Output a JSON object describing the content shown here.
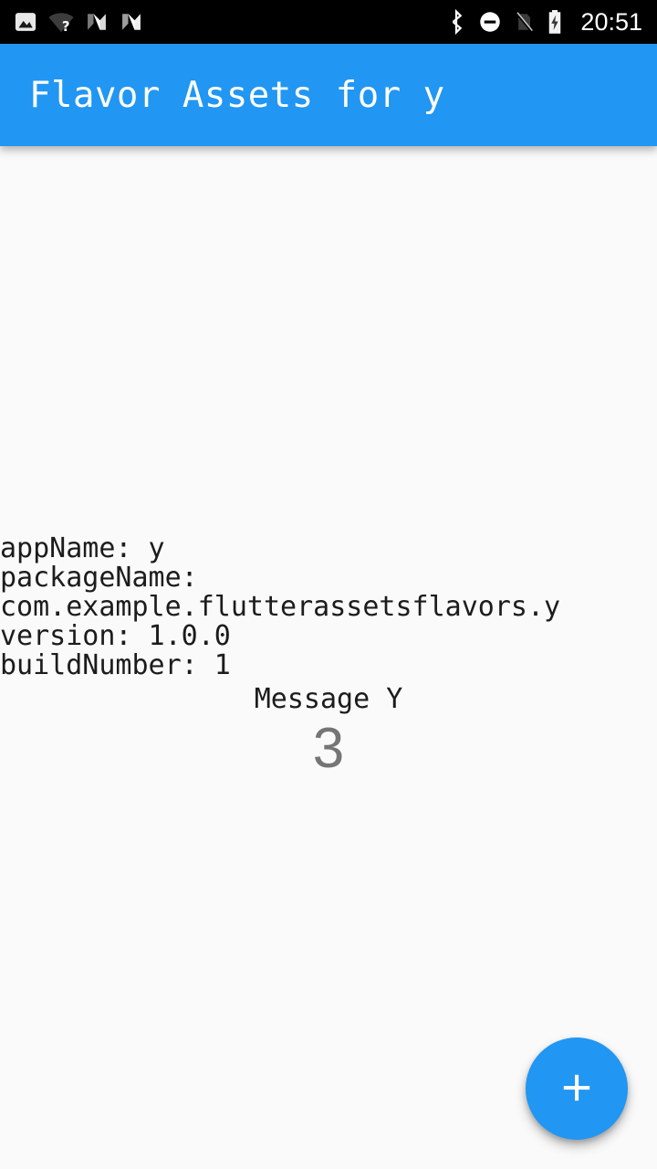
{
  "status_bar": {
    "background_color": "#000000",
    "time": "20:51",
    "left_icons": [
      {
        "name": "image-icon",
        "label": "screenshot"
      },
      {
        "name": "wifi-question-icon",
        "label": "wifi-no-internet"
      },
      {
        "name": "android-n-icon-dim",
        "label": "android-nougat-notification"
      },
      {
        "name": "android-n-icon-bright",
        "label": "android-nougat-notification"
      }
    ],
    "right_icons": [
      {
        "name": "bluetooth-icon",
        "label": "bluetooth"
      },
      {
        "name": "do-not-disturb-icon",
        "label": "do-not-disturb"
      },
      {
        "name": "sim-card-off-icon",
        "label": "no-sim-card"
      },
      {
        "name": "battery-charging-icon",
        "label": "battery-charging"
      }
    ]
  },
  "app_bar": {
    "title": "Flavor Assets for y",
    "background_color": "#2196f3",
    "text_color": "#ffffff"
  },
  "body": {
    "info_lines": [
      "appName: y",
      "packageName:",
      "com.example.flutterassetsflavors.y",
      "version: 1.0.0",
      "buildNumber: 1"
    ],
    "message_label": "Message Y",
    "counter_value": "3",
    "counter_color": "#757575",
    "background_color": "#fafafa"
  },
  "fab": {
    "icon": "plus-icon",
    "label": "+",
    "background_color": "#2196f3",
    "icon_color": "#ffffff"
  }
}
